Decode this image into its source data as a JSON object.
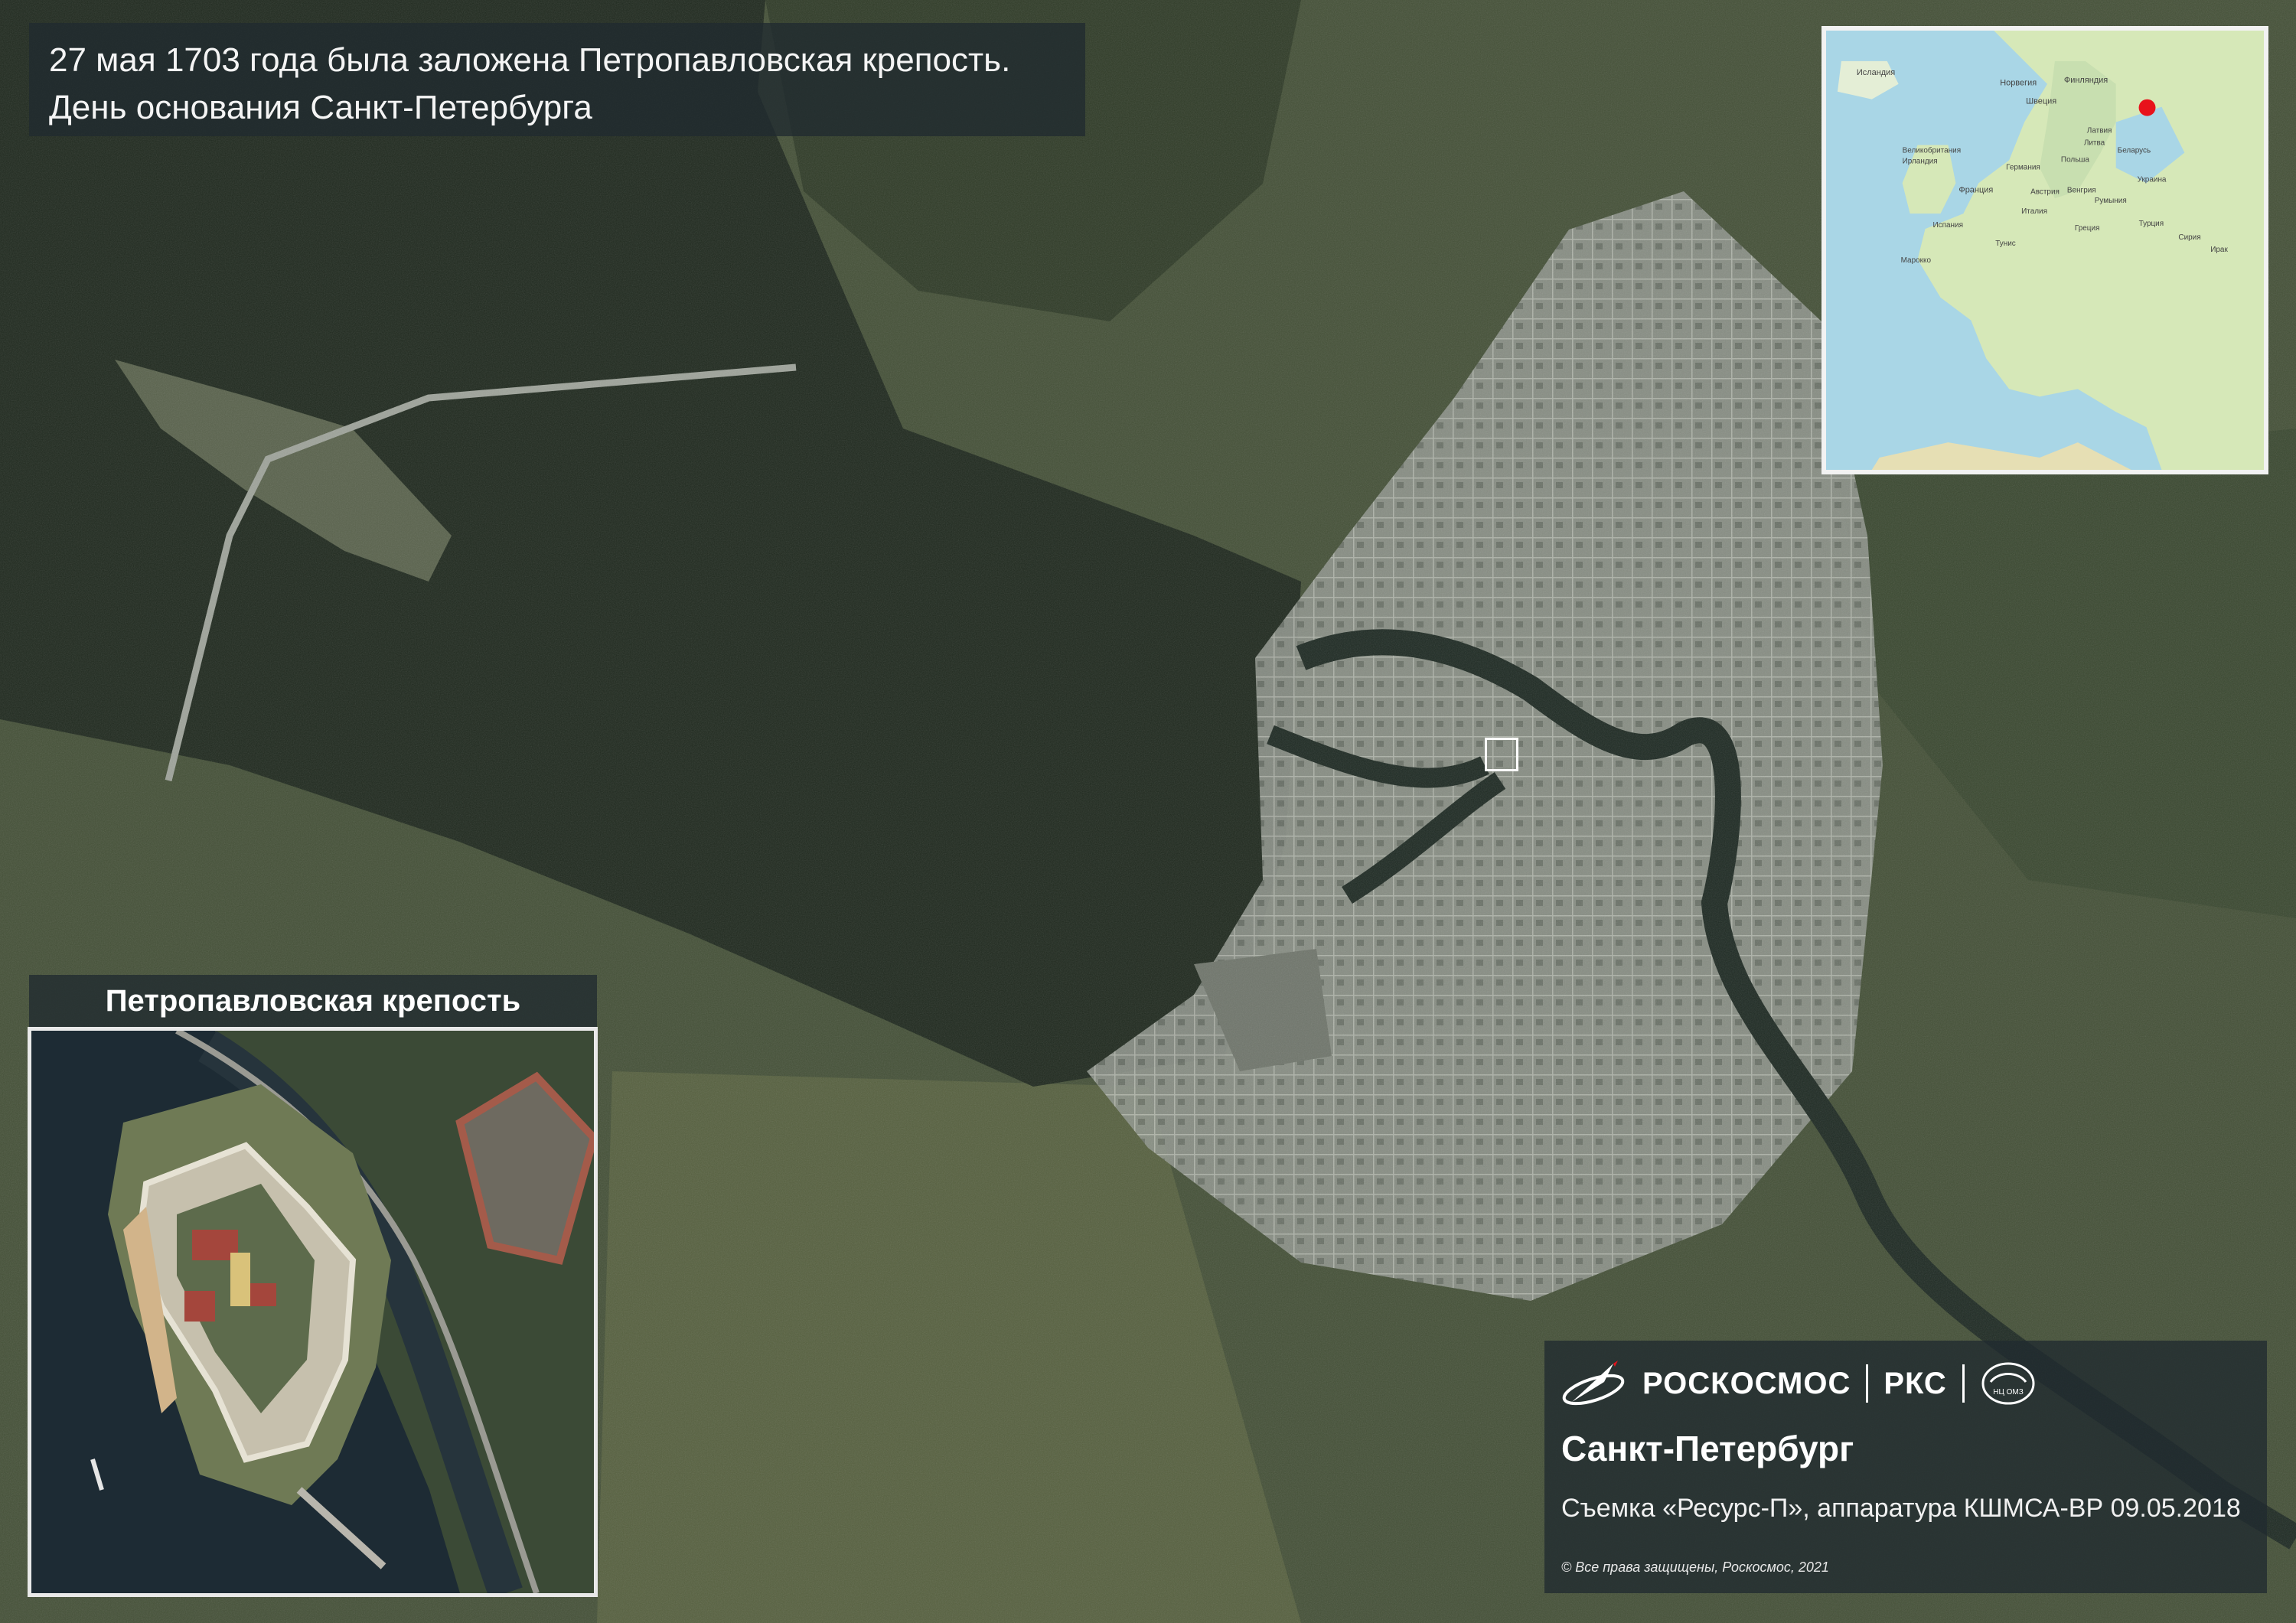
{
  "title": {
    "line1": "27 мая 1703 года была заложена Петропавловская крепость.",
    "line2": "День основания Санкт-Петербурга"
  },
  "fortress_inset": {
    "header": "Петропавловская крепость"
  },
  "locator_map": {
    "labels": {
      "iceland": "Исландия",
      "norway": "Норвегия",
      "finland": "Финляндия",
      "sweden": "Швеция",
      "latvia": "Латвия",
      "lithuania": "Литва",
      "belarus": "Беларусь",
      "uk": "Великобритания",
      "ireland": "Ирландия",
      "germany": "Германия",
      "poland": "Польша",
      "ukraine": "Украина",
      "france": "Франция",
      "austria": "Австрия",
      "hungary": "Венгрия",
      "romania": "Румыния",
      "spain": "Испания",
      "italy": "Италия",
      "greece": "Греция",
      "turkey": "Турция",
      "tunisia": "Тунис",
      "syria": "Сирия",
      "iraq": "Ирак",
      "morocco": "Марокко"
    },
    "marker_color": "#e8121b"
  },
  "info": {
    "brand_roscosmos": "РОСКОСМОС",
    "brand_rks": "РКС",
    "emblem_caption": "НЦ ОМЗ",
    "city": "Санкт-Петербург",
    "shot": "Съемка «Ресурс-П», аппаратура КШМСА-ВР 09.05.2018",
    "copyright": "© Все права защищены, Роскосмос, 2021"
  },
  "colors": {
    "water": "#1f2a1e",
    "land": "#3d4a33",
    "urban": "#8f958d",
    "panel": "#202a30",
    "marker": "#e8121b"
  }
}
